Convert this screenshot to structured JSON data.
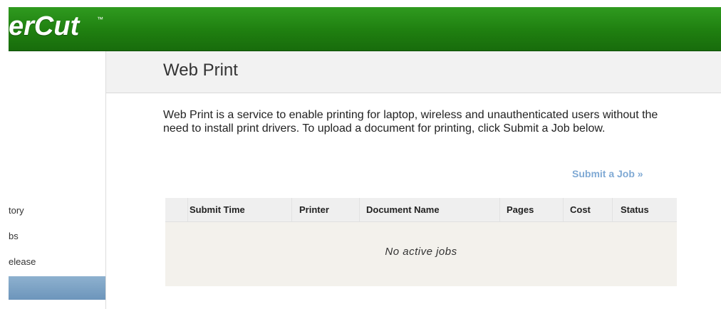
{
  "header": {
    "logo_text": "erCut",
    "logo_tm": "™",
    "color": "#1f7f10"
  },
  "sidebar": {
    "items": [
      {
        "label": "tory"
      },
      {
        "label": "bs"
      },
      {
        "label": "elease"
      }
    ],
    "active_color": "#7a9fc4"
  },
  "main": {
    "title": "Web Print",
    "description": "Web Print is a service to enable printing for laptop, wireless and unauthenticated users without the need to install print drivers. To upload a document for printing, click Submit a Job below.",
    "submit_link": "Submit a Job »",
    "link_color": "#7fa9d4"
  },
  "jobs_table": {
    "columns": [
      "Submit Time",
      "Printer",
      "Document Name",
      "Pages",
      "Cost",
      "Status"
    ],
    "rows": [],
    "empty_message": "No active jobs"
  }
}
